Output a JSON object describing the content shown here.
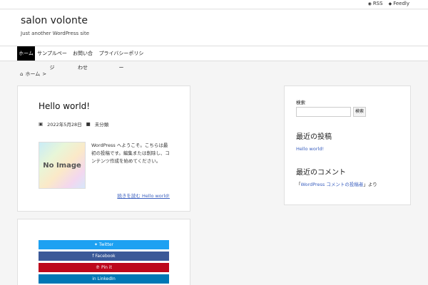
{
  "topbar": {
    "rss_icon": "rss-icon",
    "rss_label": "RSS",
    "feedly_icon": "feedly-icon",
    "feedly_label": "Feedly"
  },
  "header": {
    "site_title": "salon volonte",
    "tagline": "Just another WordPress site"
  },
  "nav": {
    "items": [
      {
        "label": "ホーム"
      },
      {
        "label": "サンプルページ"
      },
      {
        "label": "お問い合わせ"
      },
      {
        "label": "プライバシーポリシー"
      }
    ]
  },
  "breadcrumb": {
    "home_icon": "home-icon",
    "home_label": "ホーム",
    "separator": ">"
  },
  "post": {
    "title": "Hello world!",
    "date": "2022年5月28日",
    "category": "未分類",
    "thumbnail_text": "No Image",
    "excerpt": "WordPress へようこそ。こちらは最初の投稿です。編集または削除し、コンテンツ作成を始めてください。",
    "read_more": "続きを読む  Hello world!"
  },
  "share": {
    "buttons": [
      {
        "label": "Twitter",
        "color": "#1da1f2"
      },
      {
        "label": "Facebook",
        "color": "#3b5998"
      },
      {
        "label": "Pin it",
        "color": "#bd081c"
      },
      {
        "label": "LinkedIn",
        "color": "#0077b5"
      }
    ]
  },
  "sidebar": {
    "search_label": "検索",
    "search_value": "",
    "search_button": "検索",
    "recent_heading": "最近の投稿",
    "recent_posts": [
      "Hello world!"
    ],
    "comments_heading": "最近のコメント",
    "comment_prefix": "「",
    "comment_author": "WordPress コメントの投稿者",
    "comment_suffix": "」より"
  }
}
